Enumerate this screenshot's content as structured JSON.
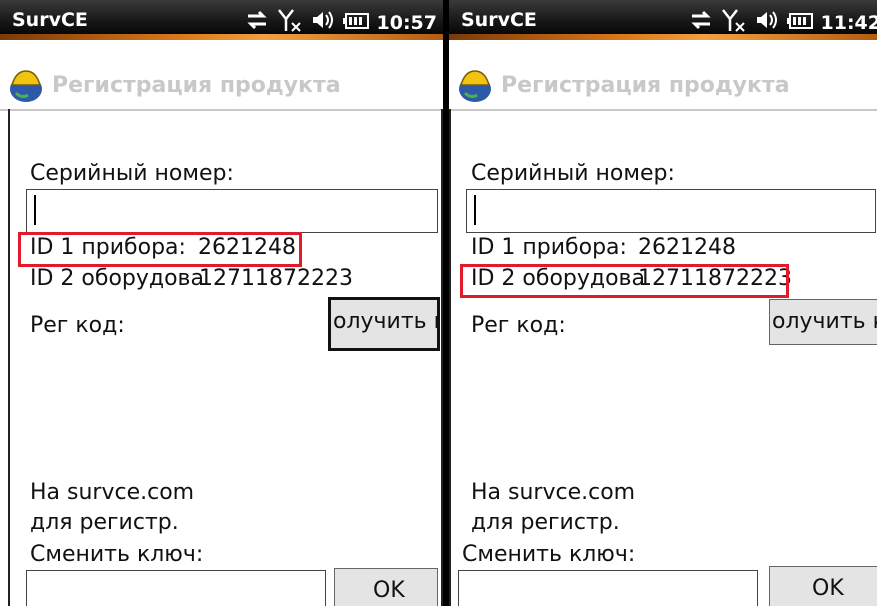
{
  "panels": [
    {
      "status_bar": {
        "app_name": "SurvCE",
        "time": "10:57"
      },
      "title": "Регистрация продукта",
      "serial_label": "Серийный номер:",
      "serial_value": "",
      "id1_label": "ID 1 прибора:",
      "id1_value": "2621248",
      "id2_label": "ID 2 оборудова",
      "id2_value": "12711872223",
      "reg_code_label": "Рег код:",
      "get_code_button": "олучить к",
      "website_line1": "На survce.com",
      "website_line2": "для регистр.",
      "change_key_label": "Сменить ключ:",
      "ok_button": "",
      "highlighted": "id1"
    },
    {
      "status_bar": {
        "app_name": "SurvCE",
        "time": "11:42"
      },
      "title": "Регистрация продукта",
      "serial_label": "Серийный номер:",
      "serial_value": "",
      "id1_label": "ID 1 прибора:",
      "id1_value": "2621248",
      "id2_label": "ID 2 оборудова",
      "id2_value": "12711872223",
      "reg_code_label": "Рег код:",
      "get_code_button": "олучить кс",
      "website_line1": "На survce.com",
      "website_line2": "для регистр.",
      "change_key_label": "Сменить ключ:",
      "ok_button": "OK",
      "highlighted": "id2"
    }
  ],
  "left_ok_button": "OK",
  "colors": {
    "highlight": "#e21b2a",
    "title_text": "#c8c8c8",
    "status_accent": "#d9771a"
  },
  "icons": [
    "connection-sync-icon",
    "no-signal-icon",
    "speaker-icon",
    "battery-icon",
    "app-logo-icon"
  ]
}
